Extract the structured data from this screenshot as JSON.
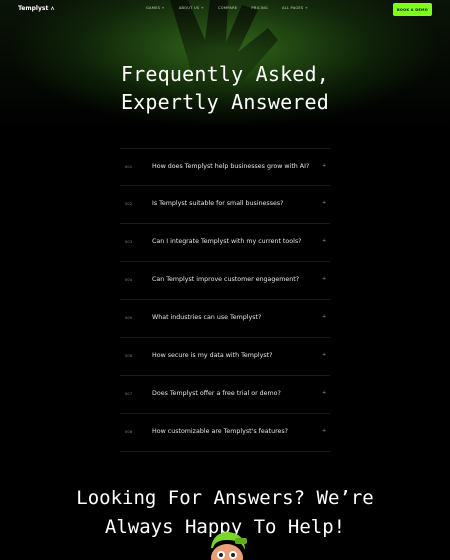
{
  "nav": {
    "logo_text": "Templyst",
    "links": [
      "GAMES +",
      "ABOUT US +",
      "COMPARE",
      "PRICING",
      "ALL PAGES +"
    ],
    "cta_label": "BOOK A DEMO"
  },
  "hero": {
    "title_line1": "Frequently Asked,",
    "title_line2": "Expertly Answered"
  },
  "faq": {
    "items": [
      {
        "num": "001",
        "question": "How does Templyst help businesses grow with AI?"
      },
      {
        "num": "002",
        "question": "Is Templyst suitable for small businesses?"
      },
      {
        "num": "003",
        "question": "Can I integrate Templyst with my current tools?"
      },
      {
        "num": "004",
        "question": "Can Templyst improve customer engagement?"
      },
      {
        "num": "005",
        "question": "What industries can use Templyst?"
      },
      {
        "num": "006",
        "question": "How secure is my data with Templyst?"
      },
      {
        "num": "007",
        "question": "Does Templyst offer a free trial or demo?"
      },
      {
        "num": "008",
        "question": "How customizable are Templyst's features?"
      }
    ],
    "expand_symbol": "+"
  },
  "cta": {
    "title_line1": "Looking For Answers? We’re",
    "title_line2": "Always Happy To Help!"
  },
  "colors": {
    "accent": "#7dff1f",
    "background": "#000000",
    "text": "#ffffff"
  },
  "icons": {
    "hero_graphic": "hand-icon",
    "logo_mark": "logo-mark-icon",
    "mascot": "avatar-3d"
  }
}
